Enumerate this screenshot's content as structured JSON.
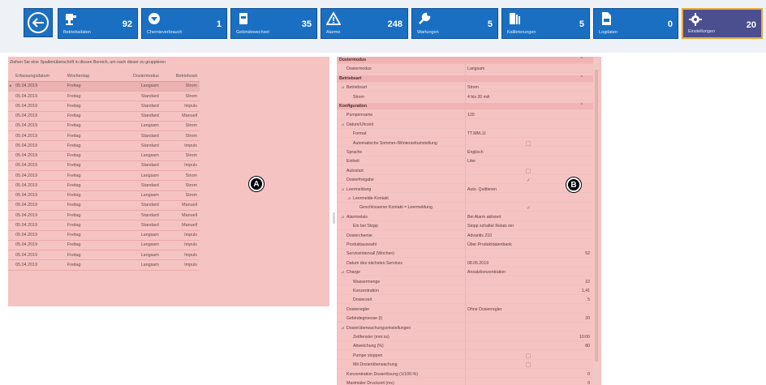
{
  "colors": {
    "tile": "#1b6fc2",
    "tile_active": "#4c4f8f",
    "active_border": "#e6a838",
    "highlight": "#f6c3c3"
  },
  "toolbar": {
    "back_icon": "arrow-left-icon",
    "tiles": [
      {
        "label": "Betriebsdaten",
        "count": "92",
        "icon": "pump-icon"
      },
      {
        "label": "Chemieverbrauch",
        "count": "1",
        "icon": "dropdown-circle-icon"
      },
      {
        "label": "Gebindewechsel",
        "count": "35",
        "icon": "container-icon"
      },
      {
        "label": "Alarme",
        "count": "248",
        "icon": "warning-icon"
      },
      {
        "label": "Wartungen",
        "count": "5",
        "icon": "wrench-icon"
      },
      {
        "label": "Kalibrierungen",
        "count": "5",
        "icon": "calibration-icon"
      },
      {
        "label": "Logdaten",
        "count": "0",
        "icon": "log-file-icon"
      },
      {
        "label": "Einstellungen",
        "count": "20",
        "icon": "gear-icon"
      }
    ]
  },
  "left_panel": {
    "group_hint": "Ziehen Sie eine Spaltenüberschrift in diesen Bereich, um nach dieser zu gruppieren",
    "columns": [
      "Erfassungsdatum",
      "Wochentag",
      "Dosiermodus",
      "Betriebsart"
    ],
    "rows": [
      [
        "05.04.2019",
        "Freitag",
        "Langsam",
        "Strom"
      ],
      [
        "05.04.2019",
        "Freitag",
        "Standard",
        "Strom"
      ],
      [
        "05.04.2019",
        "Freitag",
        "Standard",
        "Impuls"
      ],
      [
        "05.04.2019",
        "Freitag",
        "Standard",
        "Manuell"
      ],
      [
        "05.04.2019",
        "Freitag",
        "Langsam",
        "Strom"
      ],
      [
        "05.04.2019",
        "Freitag",
        "Standard",
        "Strom"
      ],
      [
        "05.04.2019",
        "Freitag",
        "Standard",
        "Impuls"
      ],
      [
        "05.04.2019",
        "Freitag",
        "Langsam",
        "Strom"
      ],
      [
        "05.04.2019",
        "Freitag",
        "Standard",
        "Impuls"
      ],
      [
        "05.04.2019",
        "Freitag",
        "Langsam",
        "Strom"
      ],
      [
        "05.04.2019",
        "Freitag",
        "Standard",
        "Strom"
      ],
      [
        "05.04.2019",
        "Freitag",
        "Langsam",
        "Strom"
      ],
      [
        "05.04.2019",
        "Freitag",
        "Standard",
        "Manuell"
      ],
      [
        "05.04.2019",
        "Freitag",
        "Standard",
        "Manuell"
      ],
      [
        "05.04.2019",
        "Freitag",
        "Standard",
        "Manuell"
      ],
      [
        "05.04.2019",
        "Freitag",
        "Langsam",
        "Impuls"
      ],
      [
        "05.04.2019",
        "Freitag",
        "Langsam",
        "Impuls"
      ],
      [
        "05.04.2019",
        "Freitag",
        "Langsam",
        "Impuls"
      ],
      [
        "05.04.2019",
        "Freitag",
        "Langsam",
        "Impuls"
      ]
    ]
  },
  "right_panel": {
    "rows": [
      {
        "type": "cat",
        "name": "Dosiermodus"
      },
      {
        "name": "Dosiermodus",
        "value": "Langsam",
        "indent": 1
      },
      {
        "type": "cat",
        "name": "Betriebsart"
      },
      {
        "name": "Betriebsart",
        "value": "Strom",
        "indent": 1,
        "exp": "⊿"
      },
      {
        "name": "Strom",
        "value": "4 bis 20 mA",
        "indent": 2
      },
      {
        "type": "cat",
        "name": "Konfiguration"
      },
      {
        "name": "Pumpenname",
        "value": "120",
        "indent": 1
      },
      {
        "name": "Datum/Uhrzeit",
        "value": "",
        "indent": 1,
        "exp": "⊿"
      },
      {
        "name": "Format",
        "value": "TT.MM.JJ",
        "indent": 2
      },
      {
        "name": "Automatische Sommer-/Winterzeitumstellung",
        "value": "",
        "indent": 2,
        "box": true
      },
      {
        "name": "Sprache",
        "value": "Englisch",
        "indent": 1
      },
      {
        "name": "Einheit",
        "value": "Liter",
        "indent": 1
      },
      {
        "name": "Autostart",
        "value": "",
        "indent": 1,
        "box": true
      },
      {
        "name": "Dosierfreigabe",
        "value": "",
        "indent": 1,
        "check": "✓"
      },
      {
        "name": "Leermeldung",
        "value": "Auto. Quittieren",
        "indent": 1,
        "exp": "⊿"
      },
      {
        "name": "Leermelde-Kontakt",
        "value": "",
        "indent": 2,
        "exp": "⊿"
      },
      {
        "name": "Geschlossener Kontakt = Leermeldung",
        "value": "",
        "indent": 3,
        "check": "✓"
      },
      {
        "name": "Alarmrelais",
        "value": "Bei Alarm aktiviert",
        "indent": 1,
        "exp": "⊿"
      },
      {
        "name": "Ein bei Stopp",
        "value": "Stopp schaltet Relais ein",
        "indent": 2
      },
      {
        "name": "Dosierchemie",
        "value": "Advantis 210",
        "indent": 1
      },
      {
        "name": "Produktauswahl",
        "value": "Über Produktdatenbank",
        "indent": 1
      },
      {
        "name": "Serviceintervall (Wochen)",
        "value": "52",
        "indent": 1,
        "num": true
      },
      {
        "name": "Datum des nächsten Services",
        "value": "08.05.2019",
        "indent": 1
      },
      {
        "name": "Charge",
        "value": "Ansatzkonzentration",
        "indent": 1,
        "exp": "⊿"
      },
      {
        "name": "Wassermenge",
        "value": "10",
        "indent": 2,
        "num": true
      },
      {
        "name": "Konzentration",
        "value": "1,41",
        "indent": 2,
        "num": true
      },
      {
        "name": "Dosierzeit",
        "value": "5",
        "indent": 2,
        "num": true
      },
      {
        "name": "Dosierregler",
        "value": "Ohne Dosierregler",
        "indent": 1
      },
      {
        "name": "Gebindegroesse (l)",
        "value": "20",
        "indent": 1,
        "num": true
      },
      {
        "name": "Dosierüberwachungseinstellungen",
        "value": "",
        "indent": 1,
        "exp": "⊿"
      },
      {
        "name": "Zeitfenster (mm:ss)",
        "value": "10:00",
        "indent": 2,
        "num": true
      },
      {
        "name": "Abweichung (%)",
        "value": "80",
        "indent": 2,
        "num": true
      },
      {
        "name": "Pumpe stoppen",
        "value": "",
        "indent": 2,
        "box": true
      },
      {
        "name": "Mit Dosierüberwachung",
        "value": "",
        "indent": 2,
        "box": true
      },
      {
        "name": "Konzentration Dosierlösung (1/100-%)",
        "value": "0",
        "indent": 1,
        "num": true
      },
      {
        "name": "Maximaler Druckzeit (ms)",
        "value": "0",
        "indent": 1,
        "num": true
      }
    ]
  },
  "markers": {
    "a": "A",
    "b": "B"
  }
}
